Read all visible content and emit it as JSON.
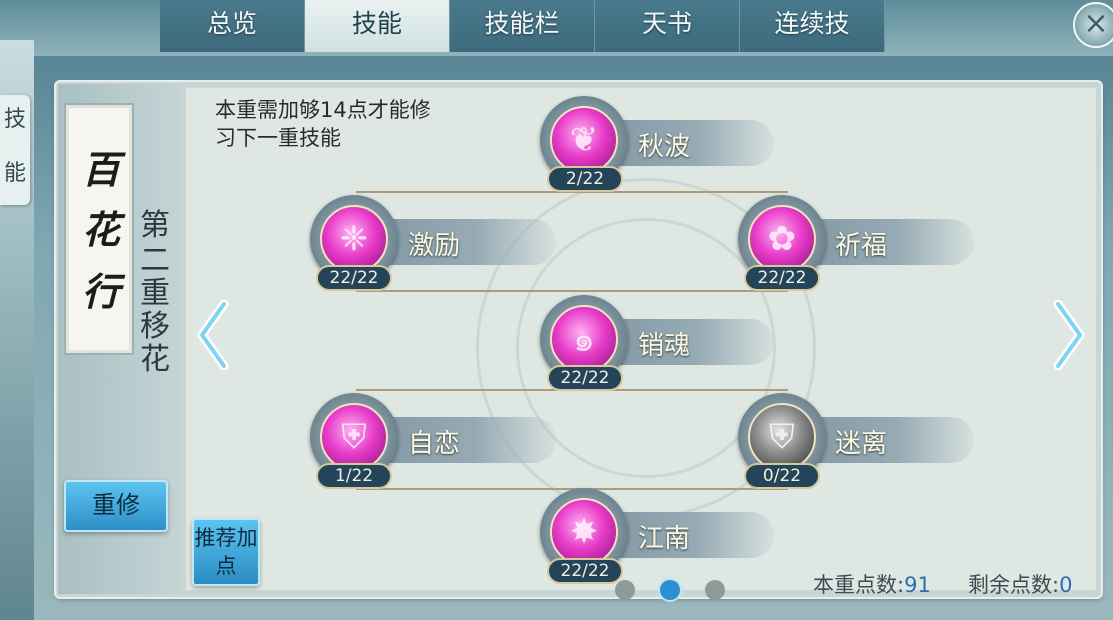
{
  "tabs": [
    {
      "label": "总览"
    },
    {
      "label": "技能",
      "active": true
    },
    {
      "label": "技能栏"
    },
    {
      "label": "天书"
    },
    {
      "label": "连续技"
    }
  ],
  "close_icon": "×",
  "side_tab": [
    "技",
    "能"
  ],
  "sect": {
    "scroll_title": [
      "百",
      "花",
      "行"
    ],
    "tier": [
      "第",
      "二",
      "重",
      "移",
      "花"
    ]
  },
  "reset_button": "重修",
  "hint": "本重需加够14点才能修习下一重技能",
  "skills": [
    {
      "name": "秋波",
      "count": "2/22",
      "icon": "petal-icon",
      "color": "pink"
    },
    {
      "name": "激励",
      "count": "22/22",
      "icon": "ornament-icon",
      "color": "pink"
    },
    {
      "name": "祈福",
      "count": "22/22",
      "icon": "lotus-icon",
      "color": "pink"
    },
    {
      "name": "销魂",
      "count": "22/22",
      "icon": "swirl-icon",
      "color": "pink"
    },
    {
      "name": "自恋",
      "count": "1/22",
      "icon": "shield-icon",
      "color": "pink"
    },
    {
      "name": "迷离",
      "count": "0/22",
      "icon": "dark-shield-icon",
      "color": "gray"
    },
    {
      "name": "江南",
      "count": "22/22",
      "icon": "burst-icon",
      "color": "pink"
    }
  ],
  "recommend_button": "推荐加点",
  "points": {
    "tier_label": "本重点数:",
    "tier_value": "91",
    "remaining_label": "剩余点数:",
    "remaining_value": "0"
  },
  "pagination": {
    "pages": 3,
    "current": 2
  },
  "colors": {
    "accent": "#2d8fd1",
    "skill_orb": "#e83cc9",
    "count_badge": "#24445a"
  }
}
